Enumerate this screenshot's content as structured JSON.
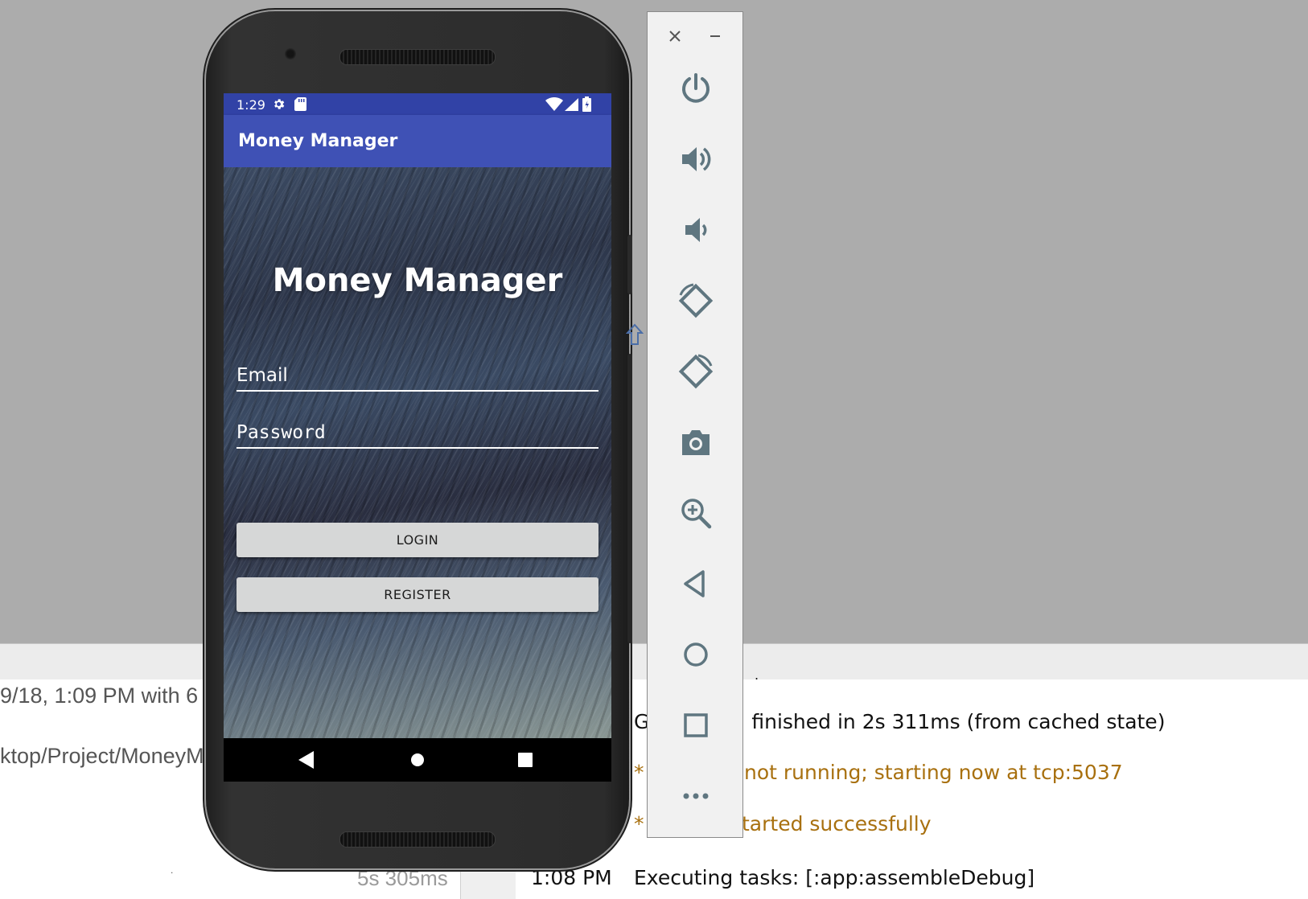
{
  "ide": {
    "log_left_date": "9/18, 1:09 PM   with 6",
    "log_left_path": "ktop/Project/MoneyM",
    "log_left_duration": "5s 305ms",
    "log_dot": ".",
    "log_time": "1:08 PM",
    "log_line_1_start": "G",
    "log_line_1_end": ": finished in 2s 311ms (from cached state)",
    "log_line_2_star": "*",
    "log_line_2": "not running; starting now at tcp:5037",
    "log_line_3_star": "*",
    "log_line_3": "tarted successfully",
    "log_line_4": "Executing tasks: [:app:assembleDebug]",
    "log_top_fragment": "."
  },
  "device": {
    "status_bar": {
      "time": "1:29",
      "icons": [
        "gear-icon",
        "sd-card-icon",
        "wifi-icon",
        "signal-icon",
        "battery-icon"
      ]
    },
    "app_bar": {
      "title": "Money Manager"
    },
    "login_screen": {
      "hero_title": "Money Manager",
      "email_placeholder": "Email",
      "password_placeholder": "Password",
      "login_label": "LOGIN",
      "register_label": "REGISTER"
    },
    "nav_bar": {
      "icons": [
        "back-icon",
        "home-icon",
        "recents-icon"
      ]
    }
  },
  "emulator_panel": {
    "buttons": [
      "close-icon",
      "minimize-icon",
      "power-icon",
      "volume-up-icon",
      "volume-down-icon",
      "rotate-left-icon",
      "rotate-right-icon",
      "camera-icon",
      "zoom-icon",
      "back-icon",
      "home-icon",
      "overview-icon",
      "more-icon"
    ]
  },
  "colors": {
    "app_bar": "#3f51b5",
    "status_bar": "#3142a6",
    "panel_icon": "#5f7680",
    "log_warning": "#a8700f"
  }
}
